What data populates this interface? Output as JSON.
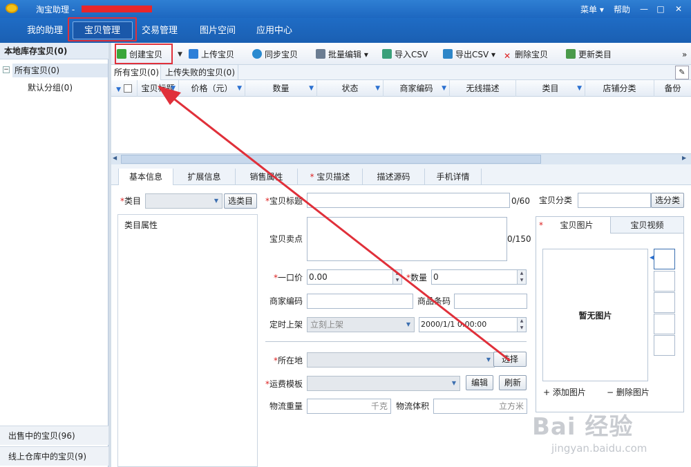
{
  "titlebar": {
    "app_title": "淘宝助理 -",
    "menu": "菜单 ▾",
    "help": "帮助",
    "minimize": "—",
    "maximize": "□",
    "close": "✕"
  },
  "nav": {
    "tabs": [
      "我的助理",
      "宝贝管理",
      "交易管理",
      "图片空间",
      "应用中心"
    ],
    "active": "宝贝管理"
  },
  "left": {
    "header": "本地库存宝贝(0)",
    "all": "所有宝贝(0)",
    "default_group": "默认分组(0)",
    "on_sale": "出售中的宝贝(96)",
    "warehouse": "线上仓库中的宝贝(9)",
    "collapse": "−"
  },
  "toolbar": {
    "create": "创建宝贝",
    "upload": "上传宝贝",
    "sync": "同步宝贝",
    "batch": "批量编辑",
    "import": "导入CSV",
    "export": "导出CSV",
    "delete": "删除宝贝",
    "update": "更新类目",
    "more": "»"
  },
  "subtabs": {
    "all": "所有宝贝(0)",
    "failed": "上传失败的宝贝(0)"
  },
  "grid": {
    "columns": [
      "宝贝标题",
      "价格（元）",
      "数量",
      "状态",
      "商家编码",
      "无线描述",
      "类目",
      "店铺分类",
      "备份"
    ]
  },
  "form_tabs": [
    "基本信息",
    "扩展信息",
    "销售属性",
    "宝贝描述",
    "描述源码",
    "手机详情"
  ],
  "form": {
    "category_label": "类目",
    "category_btn": "选类目",
    "cat_attr": "类目属性",
    "title_label": "宝贝标题",
    "title_count": "0/60",
    "selling_label": "宝贝卖点",
    "selling_count": "0/150",
    "price_label": "一口价",
    "price_value": "0.00",
    "qty_label": "数量",
    "qty_value": "0",
    "merchant_code": "商家编码",
    "barcode": "商品条码",
    "schedule_label": "定时上架",
    "schedule_value": "立刻上架",
    "schedule_time": "2000/1/1 0:00:00",
    "location_label": "所在地",
    "location_btn": "选择",
    "shipping_label": "运费模板",
    "shipping_edit": "编辑",
    "shipping_refresh": "刷新",
    "weight_label": "物流重量",
    "weight_unit": "千克",
    "volume_label": "物流体积",
    "volume_unit": "立方米",
    "shop_cat_label": "宝贝分类",
    "shop_cat_btn": "选分类"
  },
  "images": {
    "tab_pic": "宝贝图片",
    "tab_video": "宝贝视频",
    "no_image": "暂无图片",
    "add": "+ 添加图片",
    "remove": "− 删除图片"
  },
  "watermark": {
    "brand": "Bai 经验",
    "url": "jingyan.baidu.com"
  },
  "colors": {
    "accent": "#1d67c0",
    "highlight": "#e0303a"
  }
}
